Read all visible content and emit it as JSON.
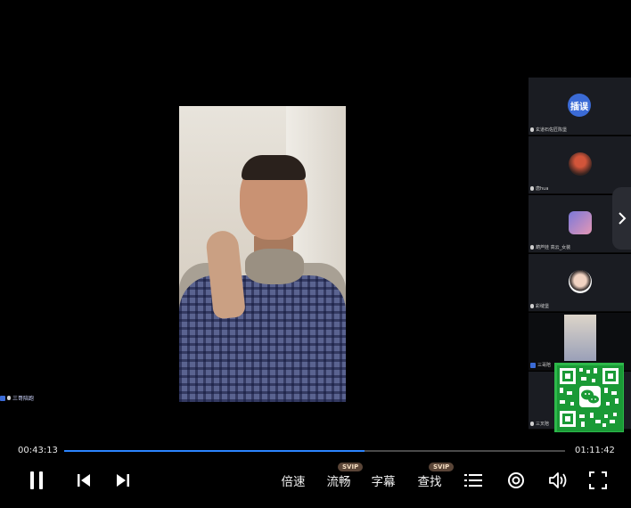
{
  "left_label": "三哥陪跑",
  "panel": {
    "badge": "插误",
    "tiles": [
      {
        "label": "玄道石佐匠陈堡"
      },
      {
        "label": "唐hua"
      },
      {
        "label": "葫芦娃 高云_女装"
      },
      {
        "label": "彩缝堡"
      },
      {
        "label": "三哥陪"
      },
      {
        "label": "三叉陪"
      }
    ]
  },
  "playback": {
    "current_time": "00:43:13",
    "total_time": "01:11:42",
    "progress_fraction": 0.6
  },
  "controls": {
    "speed_label": "倍速",
    "quality_label": "流畅",
    "subtitle_label": "字幕",
    "search_label": "查找",
    "svip_badge": "SVIP"
  },
  "colors": {
    "accent": "#2b84ff",
    "qr_green": "#2db84a"
  }
}
